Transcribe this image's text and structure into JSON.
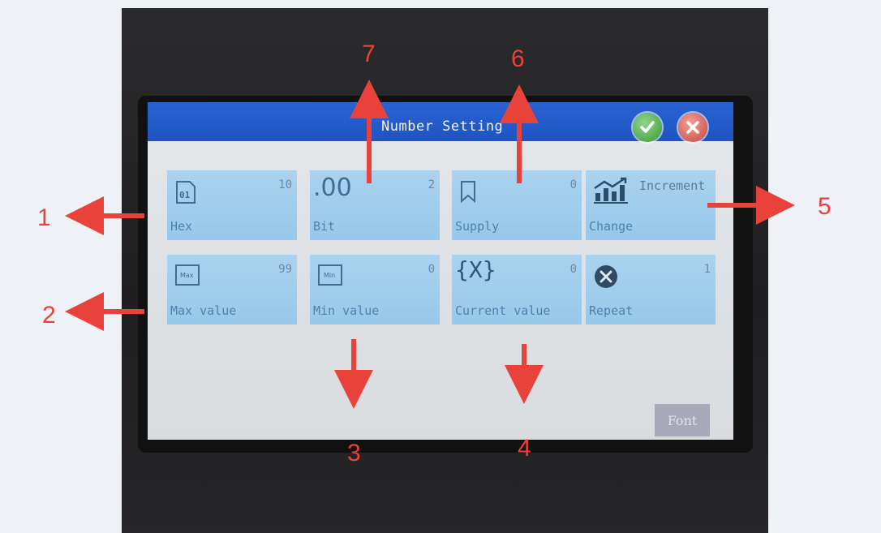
{
  "dialog": {
    "title": "Number Setting",
    "confirm_icon": "check-icon",
    "close_icon": "close-icon"
  },
  "tiles": [
    {
      "label": "Hex",
      "value": "10",
      "icon": "hex-01-icon"
    },
    {
      "label": "Bit",
      "value": "2",
      "icon_text": ".00"
    },
    {
      "label": "Supply",
      "value": "0",
      "icon": "bookmark-icon"
    },
    {
      "label": "Change",
      "value": "Increment",
      "icon": "chart-growth-icon"
    },
    {
      "label": "Max value",
      "value": "99",
      "icon_text": "Max"
    },
    {
      "label": "Min value",
      "value": "0",
      "icon_text": "Min"
    },
    {
      "label": "Current value",
      "value": "0",
      "icon_text": "{X}"
    },
    {
      "label": "Repeat",
      "value": "1",
      "icon": "tools-icon"
    }
  ],
  "font_button": "Font",
  "callouts": [
    "1",
    "2",
    "3",
    "4",
    "5",
    "6",
    "7"
  ],
  "colors": {
    "title_bar": "#1f54c2",
    "tile": "#a9d3ef",
    "callout": "#e8423a"
  }
}
